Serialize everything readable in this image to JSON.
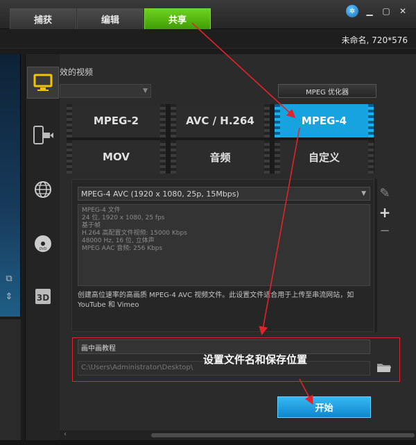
{
  "tabs": [
    {
      "label": "捕获",
      "active": false
    },
    {
      "label": "编辑",
      "active": false
    },
    {
      "label": "共享",
      "active": true
    }
  ],
  "project_info": "未命名, 720*576",
  "section_title": "效的视频",
  "optimizer_label": "MPEG 优化器",
  "formats": [
    {
      "label": "MPEG-2",
      "active": false
    },
    {
      "label": "AVC / H.264",
      "active": false
    },
    {
      "label": "MPEG-4",
      "active": true
    },
    {
      "label": "MOV",
      "active": false
    },
    {
      "label": "音频",
      "active": false
    },
    {
      "label": "自定义",
      "active": false
    }
  ],
  "profile": {
    "selected": "MPEG-4 AVC (1920 x 1080, 25p, 15Mbps)",
    "details": [
      "MPEG-4 文件",
      "24 位, 1920 x 1080, 25 fps",
      "基于帧",
      "H.264 高配置文件视频: 15000 Kbps",
      "48000 Hz, 16 位, 立体声",
      "MPEG AAC 音频: 256 Kbps"
    ],
    "description": "创建高位速率的高画质 MPEG-4 AVC 视频文件。此设置文件适合用于上传至串流网站，如 YouTube 和 Vimeo"
  },
  "output": {
    "file_name": "画中画教程",
    "path": "C:\\Users\\Administrator\\Desktop\\"
  },
  "annotation": "设置文件名和保存位置",
  "start_label": "开始",
  "colors": {
    "active_tab": "#4caf1c",
    "active_format": "#17a2e0",
    "start_button": "#1a9be0",
    "annotation": "#e0242a"
  },
  "icons": [
    "monitor-icon",
    "mobile-device-icon",
    "globe-icon",
    "disc-icon",
    "3d-icon",
    "help-icon",
    "folder-icon",
    "pencil-icon",
    "plus-icon",
    "minus-icon"
  ]
}
